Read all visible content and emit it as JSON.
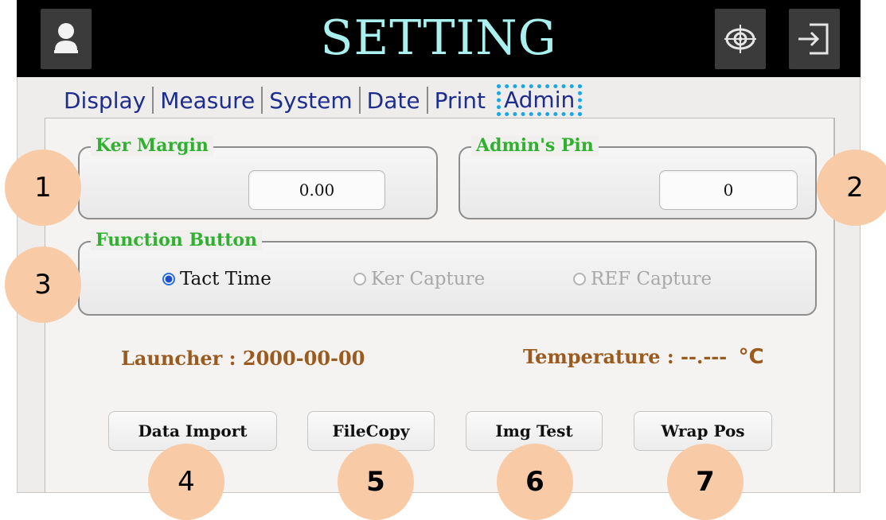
{
  "header": {
    "title": "SETTING"
  },
  "tabs": [
    "Display",
    "Measure",
    "System",
    "Date",
    "Print",
    "Admin"
  ],
  "ker_margin": {
    "legend": "Ker Margin",
    "value": "0.00"
  },
  "admin_pin": {
    "legend": "Admin's Pin",
    "value": "0"
  },
  "function_button": {
    "legend": "Function Button",
    "options": [
      {
        "label": "Tact Time",
        "selected": true
      },
      {
        "label": "Ker Capture",
        "selected": false
      },
      {
        "label": "REF Capture",
        "selected": false
      }
    ]
  },
  "launcher_text": "Launcher : 2000-00-00",
  "temperature_text": "Temperature : --.---",
  "temperature_unit": "°C",
  "buttons": [
    "Data Import",
    "FileCopy",
    "Img Test",
    "Wrap Pos"
  ],
  "callouts": [
    "1",
    "2",
    "3",
    "4",
    "5",
    "6",
    "7"
  ],
  "colors": {
    "header_bg": "#000000",
    "title": "#a9f0ef",
    "legend_green": "#2fb02f",
    "info_brown": "#9b5a1e",
    "tab_blue": "#1d2d8f",
    "active_tab_outline": "#1aa7e6",
    "callout_fill": "#f8cba6"
  },
  "icons": {
    "left": "user-icon",
    "target": "target-icon",
    "exit": "exit-icon"
  }
}
